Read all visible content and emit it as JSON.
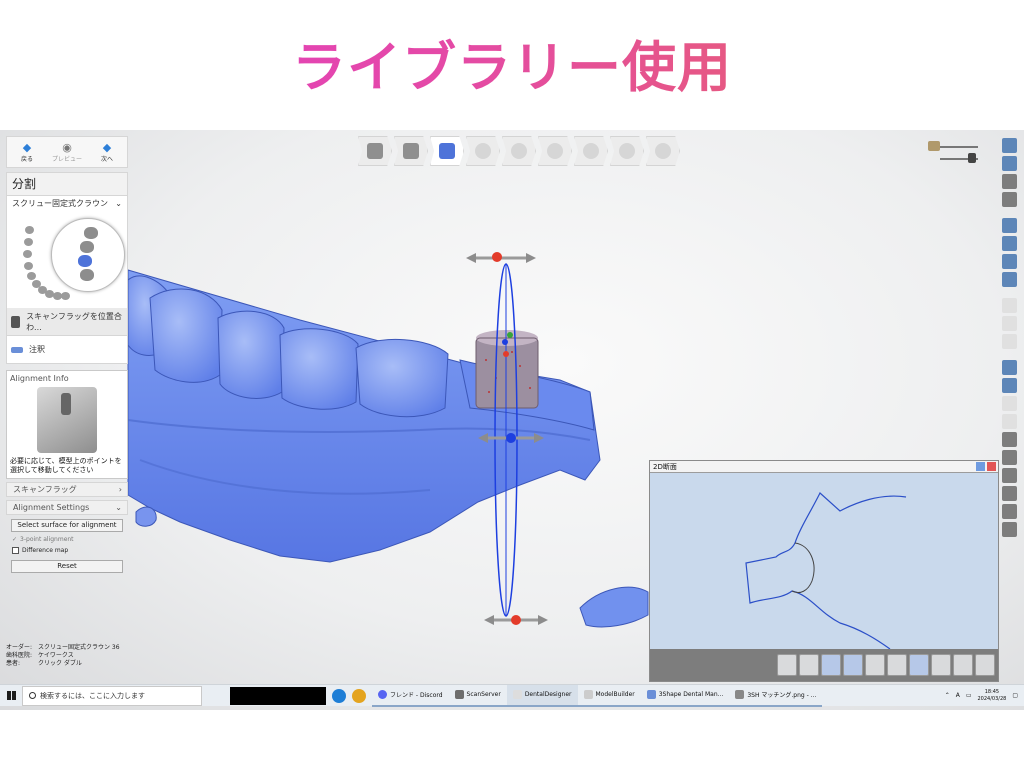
{
  "slide": {
    "title": "ライブラリー使用"
  },
  "nav": {
    "back_label": "戻る",
    "preview_label": "プレビュー",
    "next_label": "次へ"
  },
  "left_panel": {
    "section_title": "分割",
    "restoration_select": "スクリュー固定式クラウン 36",
    "items": [
      {
        "label": "スキャンフラッグを位置合わ..."
      },
      {
        "label": "注釈"
      }
    ],
    "alignment_info": {
      "title": "Alignment Info",
      "instruction": "必要に応じて、模型上のポイントを選択して移動してください"
    },
    "scan_flag_label": "スキャンフラッグ",
    "alignment_settings_label": "Alignment Settings",
    "select_surface_button": "Select surface for alignment",
    "three_point_label": "3-point alignment",
    "difference_map_label": "Difference map",
    "reset_button": "Reset"
  },
  "case_info": {
    "order_key": "オーダー:",
    "order_value": "スクリュー固定式クラウン 36",
    "lab_key": "歯科医院:",
    "lab_value": "ケイワークス",
    "patient_key": "患者:",
    "patient_value": "クリック ダブル"
  },
  "section_view": {
    "title": "2D断面"
  },
  "taskbar": {
    "search_placeholder": "検索するには、ここに入力します",
    "apps": [
      {
        "label": "フレンド - Discord",
        "active": false
      },
      {
        "label": "ScanServer",
        "active": false
      },
      {
        "label": "DentalDesigner",
        "active": true
      },
      {
        "label": "ModelBuilder",
        "active": false
      },
      {
        "label": "3Shape Dental Man...",
        "active": false
      },
      {
        "label": "3SH マッチング.png - ...",
        "active": false
      }
    ],
    "ime": "A",
    "time": "18:45",
    "date": "2024/03/28"
  },
  "colors": {
    "model_blue": "#6e8ff0",
    "manipulator_red": "#e33b2a",
    "manipulator_blue": "#1d3fe0",
    "section_curve": "#2b4fc8",
    "title_gradient_start": "#e23bc8",
    "title_gradient_end": "#e8685f"
  }
}
